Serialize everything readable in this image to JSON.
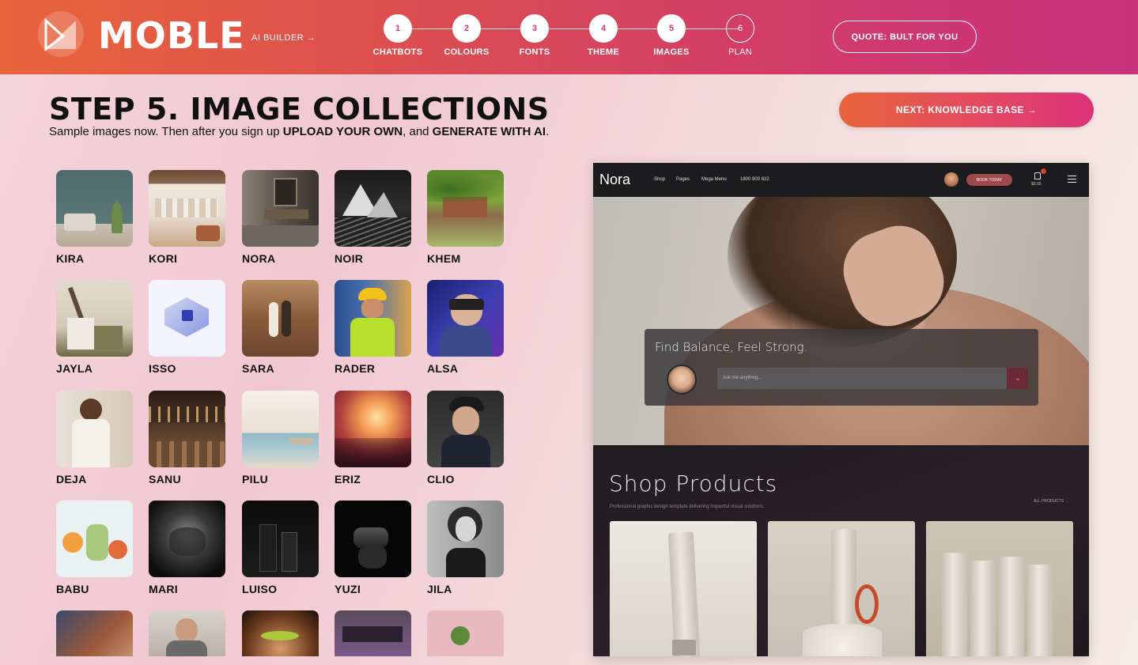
{
  "header": {
    "logo_text": "MOBLE",
    "ai_builder_label": "AI BUILDER →",
    "steps": [
      {
        "number": "1",
        "label": "CHATBOTS"
      },
      {
        "number": "2",
        "label": "COLOURS"
      },
      {
        "number": "3",
        "label": "FONTS"
      },
      {
        "number": "4",
        "label": "THEME"
      },
      {
        "number": "5",
        "label": "IMAGES"
      },
      {
        "number": "6",
        "label": "PLAN"
      }
    ],
    "quote_button": "QUOTE: BULT FOR YOU"
  },
  "page": {
    "title": "STEP 5. IMAGE COLLECTIONS",
    "subtitle_1": "Sample images now. Then after you sign up ",
    "subtitle_bold_1": "UPLOAD YOUR OWN",
    "subtitle_2": ", and ",
    "subtitle_bold_2": "GENERATE WITH AI",
    "subtitle_3": ".",
    "next_button": "NEXT: KNOWLEDGE BASE →"
  },
  "collections": [
    {
      "name": "KIRA"
    },
    {
      "name": "KORI"
    },
    {
      "name": "NORA"
    },
    {
      "name": "NOIR"
    },
    {
      "name": "KHEM"
    },
    {
      "name": "JAYLA"
    },
    {
      "name": "ISSO"
    },
    {
      "name": "SARA"
    },
    {
      "name": "RADER"
    },
    {
      "name": "ALSA"
    },
    {
      "name": "DEJA"
    },
    {
      "name": "SANU"
    },
    {
      "name": "PILU"
    },
    {
      "name": "ERIZ"
    },
    {
      "name": "CLIO"
    },
    {
      "name": "BABU"
    },
    {
      "name": "MARI"
    },
    {
      "name": "LUISO"
    },
    {
      "name": "YUZI"
    },
    {
      "name": "JILA"
    },
    {
      "name": ""
    },
    {
      "name": ""
    },
    {
      "name": ""
    },
    {
      "name": ""
    },
    {
      "name": ""
    }
  ],
  "preview": {
    "brand": "Nora",
    "nav": [
      "Shop",
      "Pages",
      "Mega Menu",
      "1800 800 822"
    ],
    "book_button": "BOOK TODAY",
    "cart_total": "$0.00",
    "hero_heading": "Find Balance, Feel Strong.",
    "chat_placeholder": "Ask me anything...",
    "send_icon": "→",
    "shop_title": "Shop Products",
    "shop_subtitle": "Professional graphic design template delivering impactful visual solutions.",
    "all_products": "ALL PRODUCTS →"
  },
  "colors": {
    "header_start": "#e8643a",
    "header_end": "#c8317b",
    "accent_pink": "#dc3279"
  }
}
